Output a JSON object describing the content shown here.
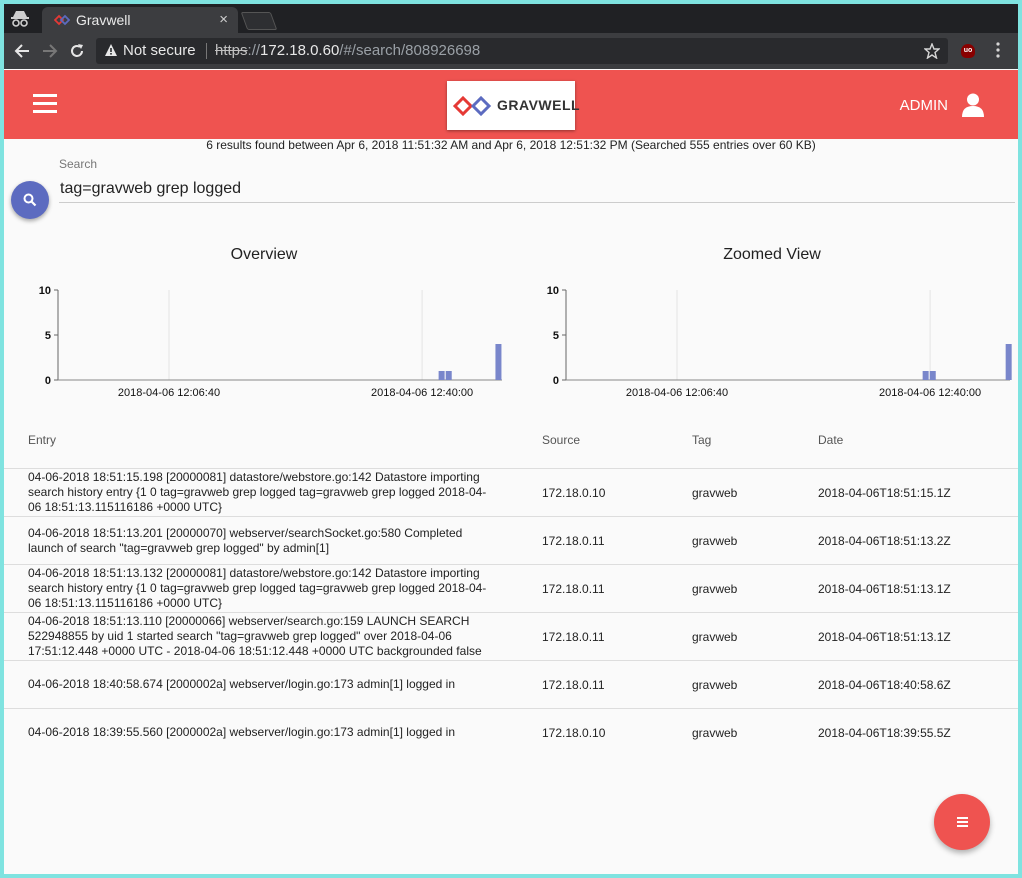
{
  "browser": {
    "tab_title": "Gravwell",
    "tab_close": "×",
    "security_label": "Not secure",
    "url_scheme": "https",
    "url_sep": "://",
    "url_host": "172.18.0.60",
    "url_path": "/#/search/808926698"
  },
  "header": {
    "logo_text": "GRAVWELL",
    "user_label": "ADMIN"
  },
  "search": {
    "summary": "6 results found between Apr 6, 2018 11:51:32 AM and Apr 6, 2018 12:51:32 PM (Searched 555 entries over 60 KB)",
    "label": "Search",
    "query": "tag=gravweb grep logged"
  },
  "chart_data": [
    {
      "type": "bar",
      "title": "Overview",
      "ylim": [
        0,
        10
      ],
      "yticks": [
        0,
        5,
        10
      ],
      "xtick_labels": [
        "2018-04-06 12:06:40",
        "2018-04-06 12:40:00"
      ],
      "bar_color": "#7986cb",
      "bars": [
        {
          "slot": 0.864,
          "value": 1
        },
        {
          "slot": 0.88,
          "value": 1
        },
        {
          "slot": 0.992,
          "value": 4
        }
      ]
    },
    {
      "type": "bar",
      "title": "Zoomed View",
      "ylim": [
        0,
        10
      ],
      "yticks": [
        0,
        5,
        10
      ],
      "xtick_labels": [
        "2018-04-06 12:06:40",
        "2018-04-06 12:40:00"
      ],
      "bar_color": "#7986cb",
      "bars": [
        {
          "slot": 0.81,
          "value": 1
        },
        {
          "slot": 0.826,
          "value": 1
        },
        {
          "slot": 0.997,
          "value": 4
        }
      ]
    }
  ],
  "table": {
    "headers": {
      "entry": "Entry",
      "source": "Source",
      "tag": "Tag",
      "date": "Date"
    },
    "rows": [
      {
        "entry": "04-06-2018 18:51:15.198 [20000081] datastore/webstore.go:142 Datastore importing search history entry {1 0 tag=gravweb grep logged tag=gravweb grep logged 2018-04-06 18:51:13.115116186 +0000 UTC}",
        "source": "172.18.0.10",
        "tag": "gravweb",
        "date": "2018-04-06T18:51:15.1Z"
      },
      {
        "entry": "04-06-2018 18:51:13.201 [20000070] webserver/searchSocket.go:580 Completed launch of search \"tag=gravweb grep logged\" by admin[1]",
        "source": "172.18.0.11",
        "tag": "gravweb",
        "date": "2018-04-06T18:51:13.2Z"
      },
      {
        "entry": "04-06-2018 18:51:13.132 [20000081] datastore/webstore.go:142 Datastore importing search history entry {1 0 tag=gravweb grep logged tag=gravweb grep logged 2018-04-06 18:51:13.115116186 +0000 UTC}",
        "source": "172.18.0.11",
        "tag": "gravweb",
        "date": "2018-04-06T18:51:13.1Z"
      },
      {
        "entry": "04-06-2018 18:51:13.110 [20000066] webserver/search.go:159 LAUNCH SEARCH 522948855 by uid 1 started search \"tag=gravweb grep logged\" over 2018-04-06 17:51:12.448 +0000 UTC - 2018-04-06 18:51:12.448 +0000 UTC backgrounded false",
        "source": "172.18.0.11",
        "tag": "gravweb",
        "date": "2018-04-06T18:51:13.1Z"
      },
      {
        "entry": "04-06-2018 18:40:58.674 [2000002a] webserver/login.go:173 admin[1] logged in",
        "source": "172.18.0.11",
        "tag": "gravweb",
        "date": "2018-04-06T18:40:58.6Z"
      },
      {
        "entry": "04-06-2018 18:39:55.560 [2000002a] webserver/login.go:173 admin[1] logged in",
        "source": "172.18.0.10",
        "tag": "gravweb",
        "date": "2018-04-06T18:39:55.5Z"
      }
    ]
  },
  "icons": {
    "incognito": "incognito-icon",
    "back": "arrow-left-icon",
    "forward": "arrow-right-icon",
    "reload": "reload-icon",
    "warning": "warning-icon",
    "star": "star-icon",
    "ublock": "ublock-icon",
    "menu": "kebab-icon",
    "hamburger": "hamburger-icon",
    "user": "user-icon",
    "search": "search-icon",
    "fab": "list-icon"
  },
  "colors": {
    "header": "#ef5350",
    "search_button": "#5c6bc0",
    "chart_bar": "#7986cb",
    "fab": "#ef5350"
  }
}
